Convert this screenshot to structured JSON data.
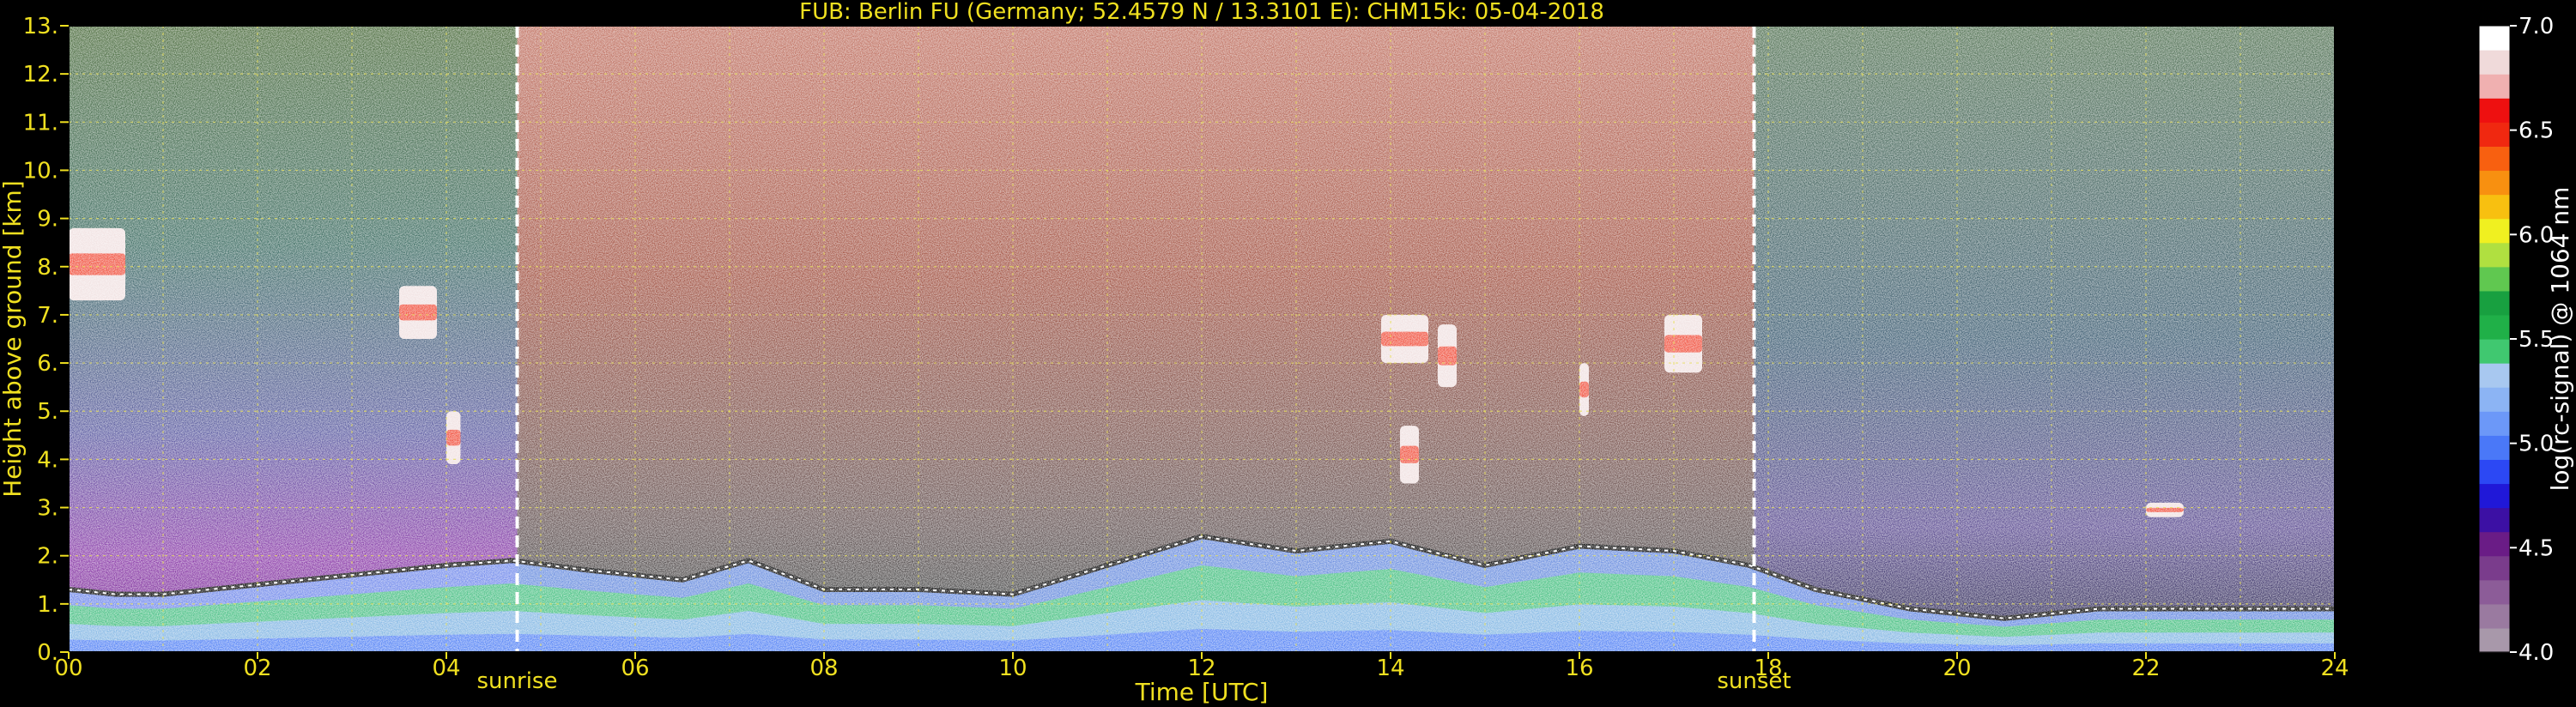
{
  "chart_data": {
    "type": "heatmap",
    "title": "FUB: Berlin FU (Germany; 52.4579 N / 13.3101 E):    CHM15k: 05-04-2018",
    "xlabel": "Time [UTC]",
    "ylabel": "Height above ground [km]",
    "xlim": [
      0,
      24
    ],
    "ylim": [
      0,
      13
    ],
    "x_ticks": [
      "00",
      "02",
      "04",
      "06",
      "08",
      "10",
      "12",
      "14",
      "16",
      "18",
      "20",
      "22",
      "24"
    ],
    "y_ticks": [
      "0.",
      "1.",
      "2.",
      "3.",
      "4.",
      "5.",
      "6.",
      "7.",
      "8.",
      "9.",
      "10.",
      "11.",
      "12.",
      "13."
    ],
    "grid": true,
    "colorbar": {
      "label": "log(rc-signal) @ 1064 nm",
      "range": [
        4.0,
        7.0
      ],
      "ticks": [
        "4.0",
        "4.5",
        "5.0",
        "5.5",
        "6.0",
        "6.5",
        "7.0"
      ],
      "colors": [
        "#a898aa",
        "#9a7aa0",
        "#8c5c98",
        "#7a3c8c",
        "#6a1c86",
        "#3c10a4",
        "#2018d8",
        "#2c48f4",
        "#4a78f8",
        "#6c98f8",
        "#8cb4f4",
        "#a8c8f0",
        "#40c870",
        "#20b048",
        "#18a040",
        "#60c850",
        "#b0e040",
        "#f0f020",
        "#f8c010",
        "#f89010",
        "#f86010",
        "#f02810",
        "#ee1010",
        "#f0b0b0",
        "#f0dada",
        "#ffffff"
      ]
    },
    "events": [
      {
        "label": "sunrise",
        "time": 4.75
      },
      {
        "label": "sunset",
        "time": 17.85
      }
    ],
    "layers": [
      {
        "t": [
          0.0,
          0.5,
          1.0,
          2.0,
          3.0,
          4.0,
          4.7,
          5.5,
          6.5,
          7.2,
          8.0,
          9.0,
          10.0,
          11.0,
          12.0,
          13.0,
          14.0,
          15.0,
          16.0,
          17.0,
          17.8,
          18.5,
          19.5,
          20.5,
          21.5,
          22.5,
          24.0
        ],
        "top_km": [
          1.3,
          1.2,
          1.2,
          1.4,
          1.6,
          1.8,
          1.9,
          1.7,
          1.5,
          1.9,
          1.3,
          1.3,
          1.2,
          1.8,
          2.4,
          2.1,
          2.3,
          1.8,
          2.2,
          2.1,
          1.8,
          1.3,
          0.9,
          0.7,
          0.9,
          0.9,
          0.9
        ]
      }
    ],
    "clouds": [
      {
        "t_start": 0.0,
        "t_end": 0.6,
        "h_low_km": 7.3,
        "h_high_km": 8.8
      },
      {
        "t_start": 3.5,
        "t_end": 3.9,
        "h_low_km": 6.5,
        "h_high_km": 7.6
      },
      {
        "t_start": 4.0,
        "t_end": 4.15,
        "h_low_km": 3.9,
        "h_high_km": 5.0
      },
      {
        "t_start": 13.9,
        "t_end": 14.4,
        "h_low_km": 6.0,
        "h_high_km": 7.0
      },
      {
        "t_start": 14.5,
        "t_end": 14.7,
        "h_low_km": 5.5,
        "h_high_km": 6.8
      },
      {
        "t_start": 14.1,
        "t_end": 14.3,
        "h_low_km": 3.5,
        "h_high_km": 4.7
      },
      {
        "t_start": 16.0,
        "t_end": 16.1,
        "h_low_km": 4.9,
        "h_high_km": 6.0
      },
      {
        "t_start": 16.9,
        "t_end": 17.3,
        "h_low_km": 5.8,
        "h_high_km": 7.0
      },
      {
        "t_start": 22.0,
        "t_end": 22.4,
        "h_low_km": 2.8,
        "h_high_km": 3.1
      }
    ]
  }
}
